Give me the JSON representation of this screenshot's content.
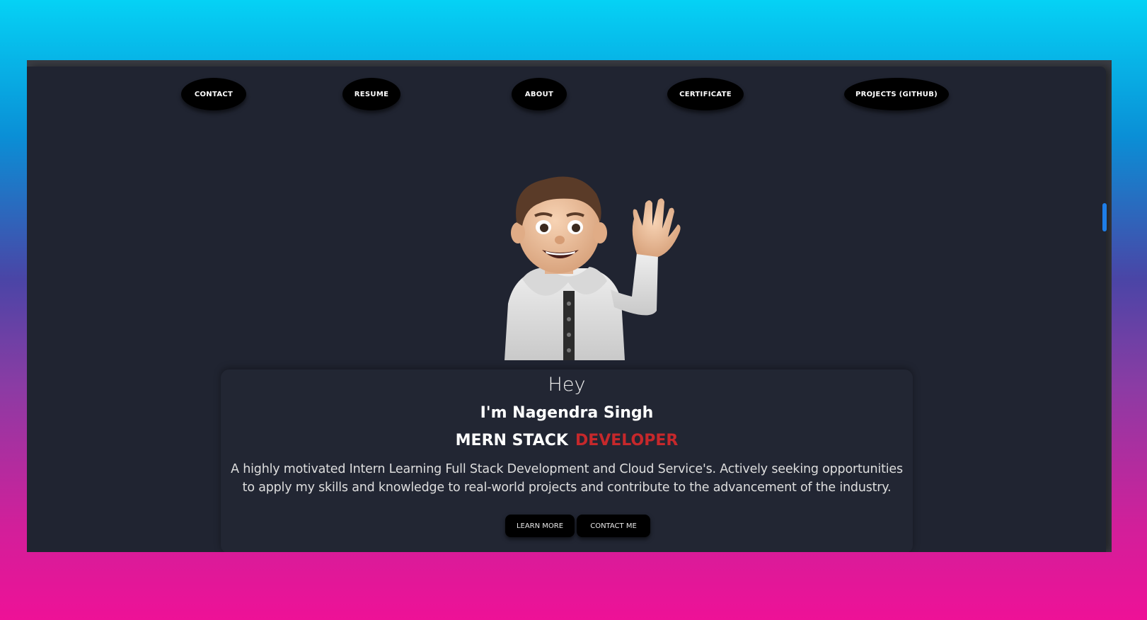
{
  "nav": {
    "contact": "CONTACT",
    "resume": "RESUME",
    "about": "ABOUT",
    "certificate": "CERTIFICATE",
    "projects": "PROJECTS (GITHUB)"
  },
  "hero": {
    "greeting": "Hey",
    "name": "I'm Nagendra Singh",
    "role_main": "MERN STACK",
    "role_accent": "DEVELOPER",
    "description_line1": "A highly motivated Intern Learning Full Stack Development and Cloud Service's. Actively seeking opportunities",
    "description_line2": "to apply my skills and knowledge to real-world projects and contribute to the advancement of the industry.",
    "avatar_icon": "memoji-waving-avatar"
  },
  "buttons": {
    "learn_more": "LEARN MORE",
    "contact_me": "CONTACT ME"
  },
  "colors": {
    "page_bg": "#202431",
    "accent_red": "#c6282b",
    "button_bg": "#000000",
    "scroll_indicator": "#1e7ee8"
  }
}
